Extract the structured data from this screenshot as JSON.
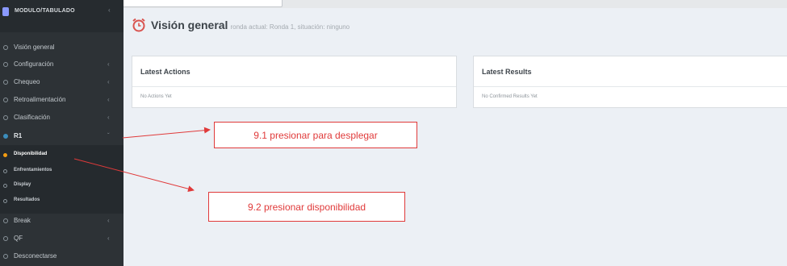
{
  "sidebar": {
    "brand": "MODULO/TABULADO",
    "items": [
      {
        "label": "Visión general",
        "has_chevron": false
      },
      {
        "label": "Configuración",
        "has_chevron": true
      },
      {
        "label": "Chequeo",
        "has_chevron": true
      },
      {
        "label": "Retroalimentación",
        "has_chevron": true
      },
      {
        "label": "Clasificación",
        "has_chevron": true
      },
      {
        "label": "R1",
        "has_chevron": true,
        "expanded": true
      }
    ],
    "sub_items": [
      {
        "label": "Disponibilidad",
        "active": true
      },
      {
        "label": "Enfrentamientos",
        "active": false
      },
      {
        "label": "Display",
        "active": false
      },
      {
        "label": "Resultados",
        "active": false
      }
    ],
    "bottom_items": [
      {
        "label": "Break",
        "has_chevron": true
      },
      {
        "label": "QF",
        "has_chevron": true
      },
      {
        "label": "Desconectarse",
        "has_chevron": false
      }
    ]
  },
  "header": {
    "title": "Visión general",
    "subtitle": "ronda actual: Ronda 1, situación: ninguno"
  },
  "panels": {
    "latest_actions": {
      "title": "Latest Actions",
      "body": "No Actions Yet"
    },
    "latest_results": {
      "title": "Latest Results",
      "body": "No Confirmed Results Yet"
    }
  },
  "annotations": {
    "step1": "9.1 presionar para desplegar",
    "step2": "9.2 presionar disponibilidad"
  },
  "colors": {
    "sidebar_bg": "#2d3236",
    "active_dot": "#f39c12",
    "info_dot": "#3c8dbc",
    "annotation_red": "#e03a3a",
    "alarm_icon": "#d9534f"
  }
}
